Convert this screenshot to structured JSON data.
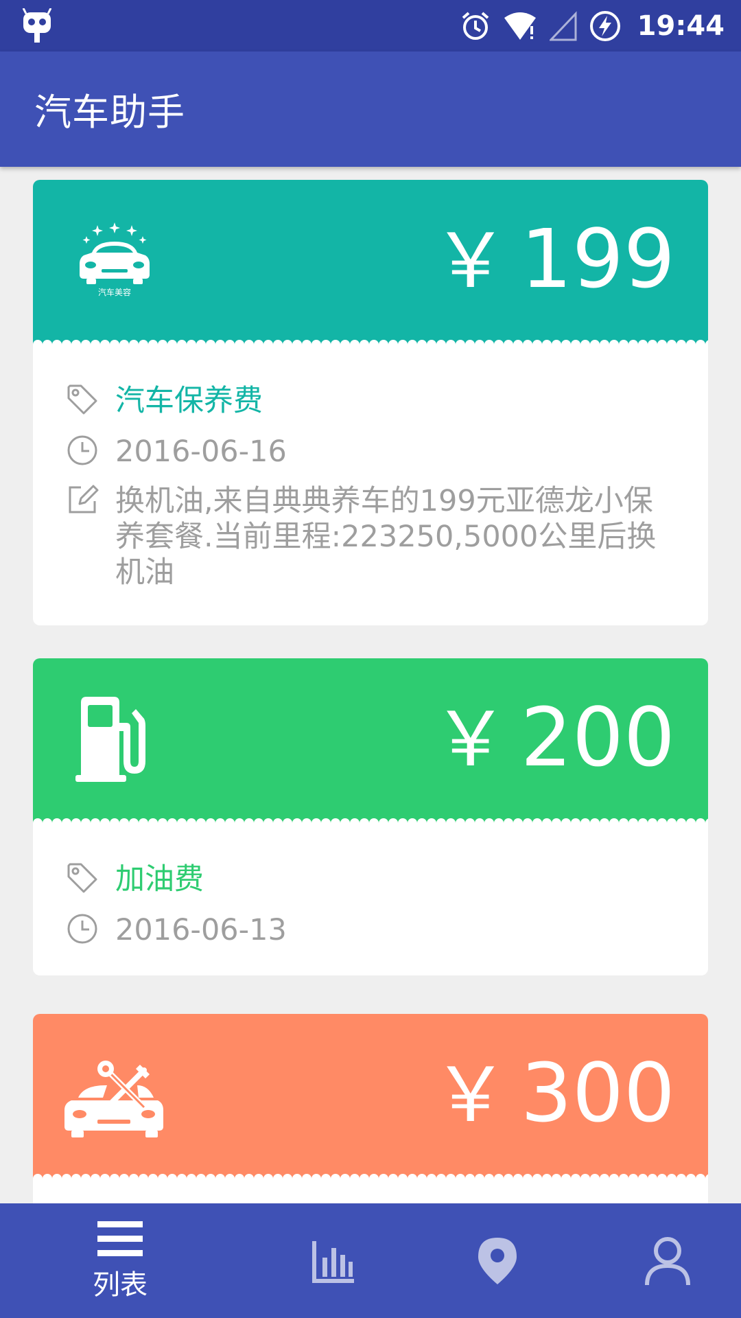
{
  "status_bar": {
    "time": "19:44",
    "icons": [
      "android-icon",
      "alarm-icon",
      "wifi-icon",
      "signal-icon",
      "battery-charging-icon"
    ]
  },
  "app_bar": {
    "title": "汽车助手"
  },
  "colors": {
    "primary": "#3f51b5",
    "primary_dark": "#303f9f",
    "teal": "#13b5a6",
    "green": "#2ecc71",
    "salmon": "#ff8a65",
    "grey_text": "#9e9e9e"
  },
  "records": [
    {
      "amount": "199",
      "currency": "￥",
      "icon": "car-beauty-icon",
      "icon_caption": "汽车美容",
      "category": "汽车保养费",
      "date": "2016-06-16",
      "note": "换机油,来自典典养车的199元亚德龙小保养套餐.当前里程:223250,5000公里后换机油"
    },
    {
      "amount": "200",
      "currency": "￥",
      "icon": "fuel-pump-icon",
      "category": "加油费",
      "date": "2016-06-13"
    },
    {
      "amount": "300",
      "currency": "￥",
      "icon": "car-repair-icon"
    }
  ],
  "bottom_nav": {
    "items": [
      {
        "icon": "list-icon",
        "label": "列表",
        "active": true
      },
      {
        "icon": "bar-chart-icon",
        "label": "",
        "active": false
      },
      {
        "icon": "location-pin-icon",
        "label": "",
        "active": false
      },
      {
        "icon": "person-icon",
        "label": "",
        "active": false
      }
    ]
  }
}
